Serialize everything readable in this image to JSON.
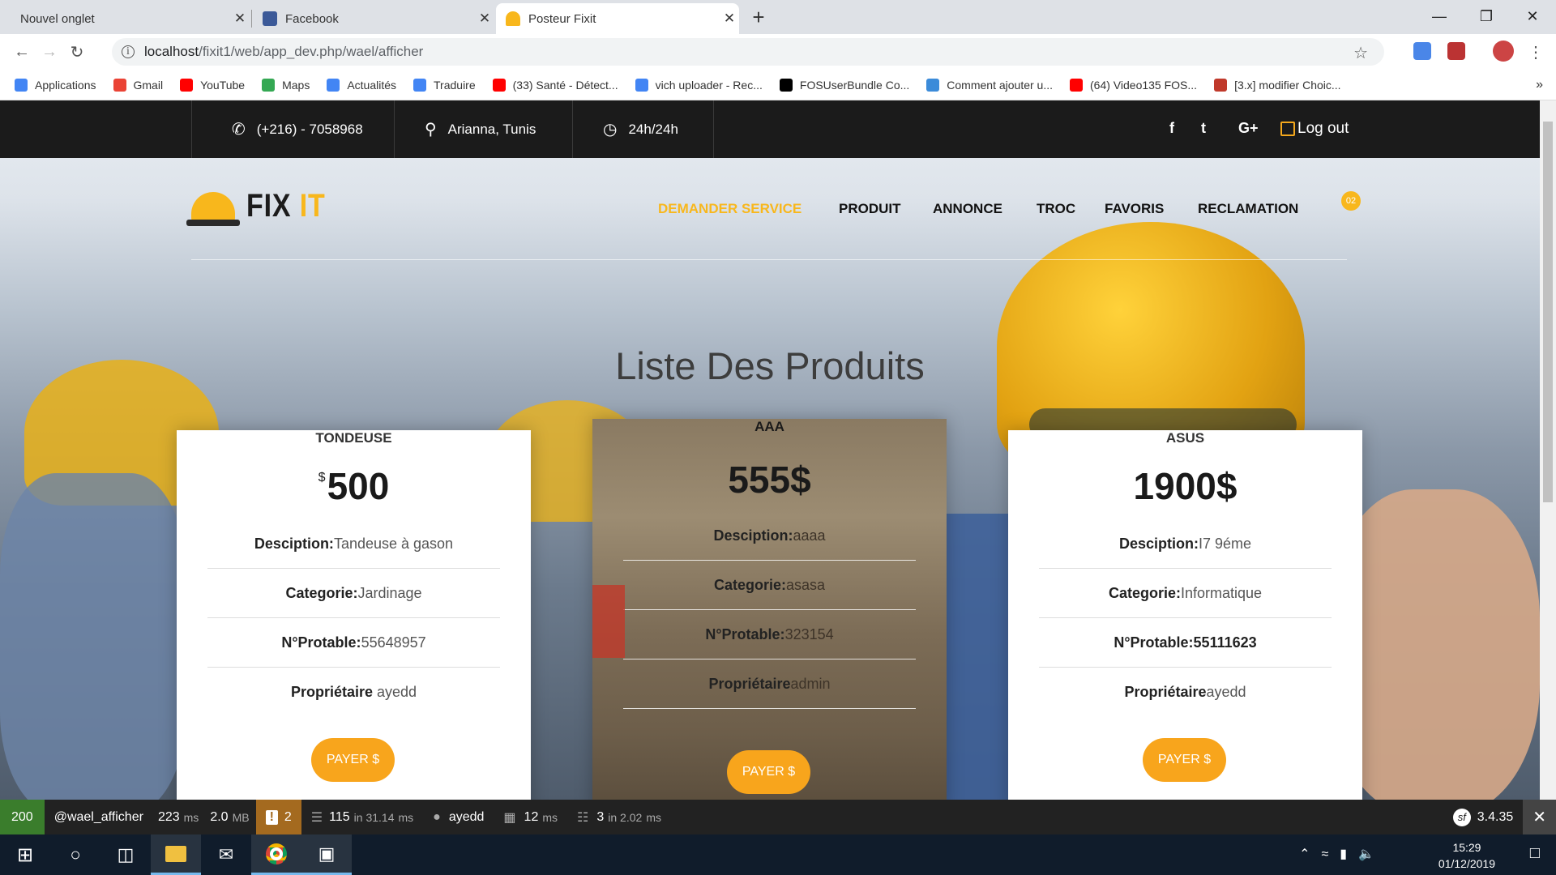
{
  "browser": {
    "tabs": [
      {
        "title": "Nouvel onglet",
        "close": "✕"
      },
      {
        "title": "Facebook",
        "close": "✕"
      },
      {
        "title": "Posteur Fixit",
        "close": "✕"
      }
    ],
    "new_tab": "+",
    "url_host": "localhost",
    "url_path": "/fixit1/web/app_dev.php/wael/afficher",
    "bookmarks": [
      {
        "label": "Applications",
        "icon": "apps-grid-icon",
        "color": "#4285f4"
      },
      {
        "label": "Gmail",
        "icon": "gmail-icon",
        "color": "#ea4335"
      },
      {
        "label": "YouTube",
        "icon": "youtube-icon",
        "color": "#ff0000"
      },
      {
        "label": "Maps",
        "icon": "maps-icon",
        "color": "#34a853"
      },
      {
        "label": "Actualités",
        "icon": "news-icon",
        "color": "#4285f4"
      },
      {
        "label": "Traduire",
        "icon": "translate-icon",
        "color": "#4285f4"
      },
      {
        "label": "(33) Santé - Détect...",
        "icon": "youtube-icon",
        "color": "#ff0000"
      },
      {
        "label": "vich uploader - Rec...",
        "icon": "google-icon",
        "color": "#4285f4"
      },
      {
        "label": "FOSUserBundle Co...",
        "icon": "symfony-icon",
        "color": "#000000"
      },
      {
        "label": "Comment ajouter u...",
        "icon": "code-icon",
        "color": "#3b8bd9"
      },
      {
        "label": "(64) Video135 FOS...",
        "icon": "youtube-icon",
        "color": "#ff0000"
      },
      {
        "label": "[3.x] modifier Choic...",
        "icon": "bookmark-icon",
        "color": "#c0392b"
      }
    ],
    "more": "»"
  },
  "topbar": {
    "phone": "(+216) - 7058968",
    "location": "Arianna, Tunis",
    "hours": "24h/24h",
    "social": [
      "f",
      "t",
      "G+"
    ],
    "logout": "Log out"
  },
  "nav": {
    "logo_a": "FIX",
    "logo_b": "IT",
    "items": [
      "DEMANDER SERVICE",
      "PRODUIT",
      "ANNONCE",
      "TROC",
      "FAVORIS",
      "RECLAMATION"
    ],
    "cart_count": "02"
  },
  "heading": "Liste Des Produits",
  "products": [
    {
      "name": "TONDEUSE",
      "currency": "$",
      "price": "500",
      "desc_label": "Desciption:",
      "desc": "Tandeuse à gason",
      "cat_label": "Categorie:",
      "cat": "Jardinage",
      "tel_label": "N°Protable:",
      "tel": "55648957",
      "owner_label": "Propriétaire",
      "owner": "ayedd",
      "pay": "PAYER $"
    },
    {
      "name": "AAA",
      "price": "555$",
      "desc_label": "Desciption:",
      "desc": "aaaa",
      "cat_label": "Categorie:",
      "cat": "asasa",
      "tel_label": "N°Protable:",
      "tel": "323154",
      "owner_label": "Propriétaire",
      "owner": "admin",
      "pay": "PAYER $"
    },
    {
      "name": "ASUS",
      "price": "1900$",
      "desc_label": "Desciption:",
      "desc": "I7 9éme",
      "cat_label": "Categorie:",
      "cat": "Informatique",
      "tel_label": "N°Protable:",
      "tel": "55111623",
      "owner_label": "Propriétaire",
      "owner": "ayedd",
      "pay": "PAYER $"
    }
  ],
  "debugbar": {
    "status": "200",
    "route": "@wael_afficher",
    "time": "223",
    "time_unit": "ms",
    "memory": "2.0",
    "memory_unit": "MB",
    "warnings": "2",
    "queries": "115",
    "queries_in": "in 31.14",
    "queries_unit": "ms",
    "user": "ayedd",
    "twig": "12",
    "twig_unit": "ms",
    "cache": "3",
    "cache_in": "in 2.02",
    "cache_unit": "ms",
    "version": "3.4.35"
  },
  "taskbar": {
    "time": "15:29",
    "date": "01/12/2019"
  },
  "colors": {
    "accent": "#f8b71c",
    "dark": "#1b1b1b",
    "debug_green": "#3a7d2c",
    "debug_warn": "#a46a1f"
  }
}
